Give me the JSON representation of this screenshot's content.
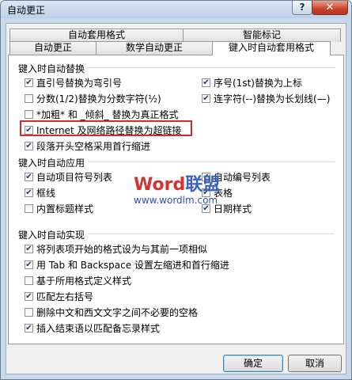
{
  "window": {
    "title": "自动更正",
    "help_label": "?",
    "close_label": "✕"
  },
  "tabs_back": [
    "自动套用格式",
    "智能标记"
  ],
  "tabs_front": [
    "自动更正",
    "数学自动更正",
    "键入时自动套用格式"
  ],
  "sections": {
    "replace": "键入时自动替换",
    "apply": "键入时自动应用",
    "implement": "键入时自动实现"
  },
  "replace_options": [
    {
      "label": "直引号替换为弯引号",
      "checked": true
    },
    {
      "label": "序号(1st)替换为上标",
      "checked": true
    },
    {
      "label": "分数(1/2)替换为分数字符(½)",
      "checked": false
    },
    {
      "label": "连字符(--)替换为长划线(—)",
      "checked": true
    },
    {
      "label": "*加粗* 和 _倾斜_ 替换为真正格式",
      "checked": false
    },
    {
      "label": "Internet 及网络路径替换为超链接",
      "checked": true
    },
    {
      "label": "段落开头空格采用首行缩进",
      "checked": true
    }
  ],
  "apply_options": [
    {
      "label": "自动项目符号列表",
      "checked": true
    },
    {
      "label": "自动编号列表",
      "checked": true
    },
    {
      "label": "框线",
      "checked": true
    },
    {
      "label": "表格",
      "checked": true
    },
    {
      "label": "内置标题样式",
      "checked": false
    },
    {
      "label": "日期样式",
      "checked": true
    }
  ],
  "implement_options": [
    {
      "label": "将列表项开始的格式设为与其前一项相似",
      "checked": true
    },
    {
      "label": "用 Tab 和 Backspace 设置左缩进和首行缩进",
      "checked": true
    },
    {
      "label": "基于所用格式定义样式",
      "checked": false
    },
    {
      "label": "匹配左右括号",
      "checked": true
    },
    {
      "label": "删除中文和西文文字之间不必要的空格",
      "checked": false
    },
    {
      "label": "插入结束语以匹配备忘录样式",
      "checked": true
    }
  ],
  "watermark": {
    "logo_latin": "Word",
    "logo_cn": "联盟",
    "url": "www.wordlm.com"
  },
  "buttons": {
    "ok": "确定",
    "cancel": "取消"
  },
  "checkmark": "✔"
}
